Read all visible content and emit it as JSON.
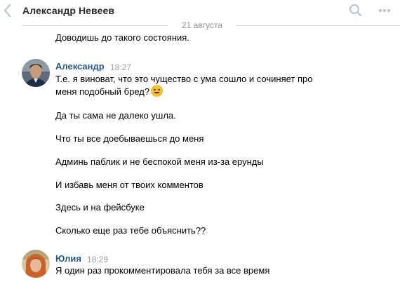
{
  "header": {
    "title": "Александр Невеев",
    "back_icon": "chevron-left-icon",
    "search_icon": "search-icon",
    "more_icon": "more-dots-icon"
  },
  "date_separator": "21 августа",
  "messages": [
    {
      "author": "",
      "time": "",
      "texts": [
        "Доводишь до такого состояния."
      ]
    },
    {
      "author": "Александр",
      "time": "18:27",
      "texts": [
        "Т.е. я виноват, что это чущество с ума сошло и сочиняет про",
        "меня подобный бред?",
        "Да ты сама не далеко ушла.",
        "Что ты все доебываешься до меня",
        "Админь паблик и не беспокой меня из-за ерунды",
        "И избавь меня от твоих комментов",
        "Здесь и на фейсбуке",
        "Сколько еще раз тебе объяснить??"
      ],
      "emoji": "laughing-face-emoji"
    },
    {
      "author": "Юлия",
      "time": "18:29",
      "texts": [
        "Я один раз прокомментировала тебя за все время"
      ]
    }
  ],
  "colors": {
    "author_link": "#2a5885",
    "time": "#a0a0a0",
    "separator": "#dfe3e8",
    "date": "#939393",
    "header_icons": "#b9c1cb"
  }
}
